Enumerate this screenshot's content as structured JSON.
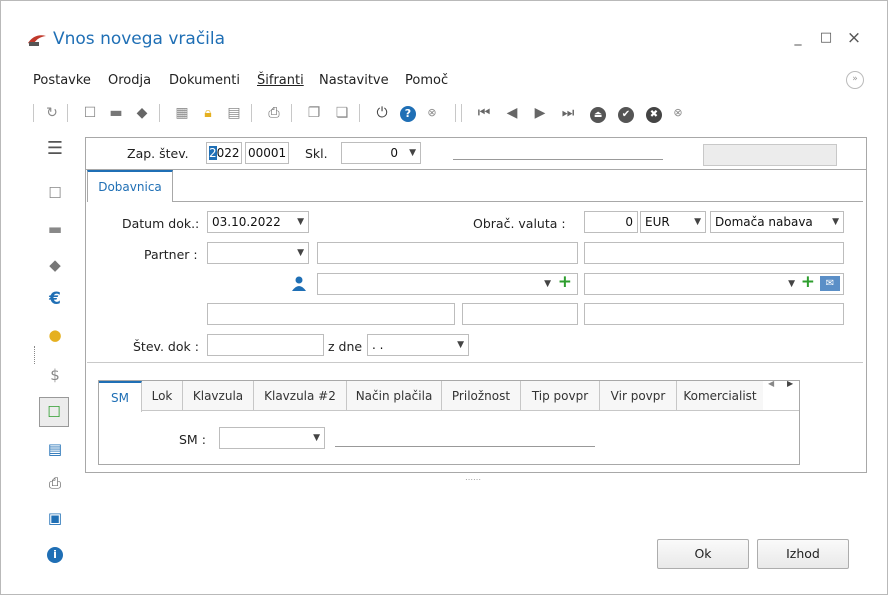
{
  "window": {
    "title": "Vnos novega vračila",
    "minimize": "_",
    "maximize": "□",
    "close": "×"
  },
  "menu": [
    {
      "label": "Postavke"
    },
    {
      "label": "Orodja"
    },
    {
      "label": "Dokumenti"
    },
    {
      "label": "Šifranti"
    },
    {
      "label": "Nastavitve"
    },
    {
      "label": "Pomoč"
    }
  ],
  "header": {
    "zap_label": "Zap. štev.",
    "zap_cursor": "2",
    "zap_year": "022",
    "zap_number": "00001",
    "skl_label": "Skl.",
    "skl_value": "0"
  },
  "doc_tab": "Dobavnica",
  "form": {
    "datum_label": "Datum dok.:",
    "datum_value": "03.10.2022",
    "valuta_label": "Obrač. valuta :",
    "valuta_amount": "0",
    "valuta_code": "EUR",
    "nabava_value": "Domača nabava",
    "partner_label": "Partner :",
    "stev_label": "Štev. dok :",
    "zdne_label": "z dne",
    "zdne_value": ".  ."
  },
  "bottom_tabs": [
    {
      "label": "SM"
    },
    {
      "label": "Lok"
    },
    {
      "label": "Klavzula"
    },
    {
      "label": "Klavzula #2"
    },
    {
      "label": "Način plačila"
    },
    {
      "label": "Priložnost"
    },
    {
      "label": "Tip povpr"
    },
    {
      "label": "Vir povpr"
    },
    {
      "label": "Komercialist"
    }
  ],
  "sm": {
    "label": "SM :"
  },
  "buttons": {
    "ok": "Ok",
    "izhod": "Izhod"
  },
  "colors": {
    "accent": "#1f6fb5",
    "green": "#2e9e2e"
  }
}
